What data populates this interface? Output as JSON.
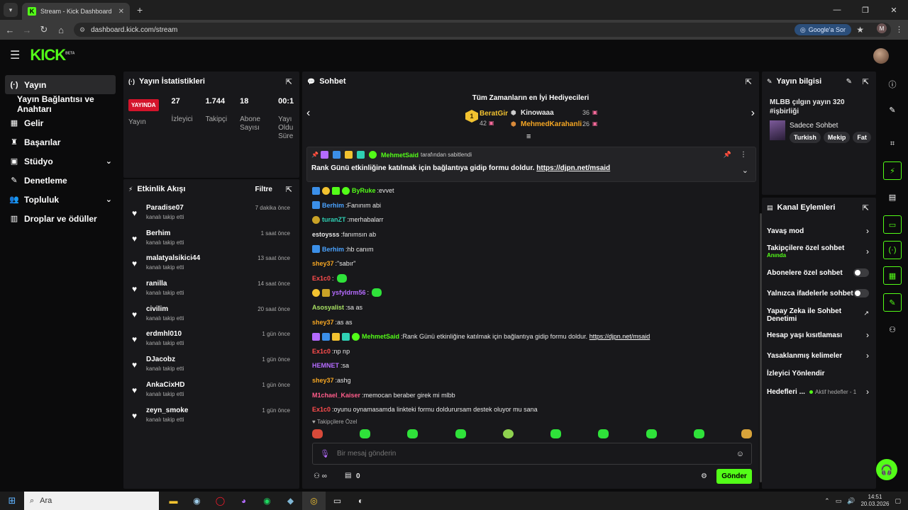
{
  "browser": {
    "tab_title": "Stream - Kick Dashboard",
    "url": "dashboard.kick.com/stream",
    "google_btn": "Google'a Sor",
    "profile_initial": "M"
  },
  "brand": {
    "logo": "KICK",
    "beta": "BETA",
    "accent": "#53fc18"
  },
  "sidebar": {
    "items": [
      {
        "icon": "(·)",
        "label": "Yayın"
      },
      {
        "icon": "",
        "label": "Yayın Bağlantısı ve Anahtarı"
      },
      {
        "icon": "▦",
        "label": "Gelir"
      },
      {
        "icon": "♜",
        "label": "Başarılar"
      },
      {
        "icon": "▣",
        "label": "Stüdyo"
      },
      {
        "icon": "✎",
        "label": "Denetleme"
      },
      {
        "icon": "👥",
        "label": "Topluluk"
      },
      {
        "icon": "▥",
        "label": "Droplar ve ödüller"
      }
    ]
  },
  "stats": {
    "title": "Yayın İstatistikleri",
    "live": "YAYINDA",
    "live_label": "Yayın",
    "viewers": "27",
    "viewers_label": "İzleyici",
    "followers": "1.744",
    "followers_label": "Takipçi",
    "subs": "18",
    "subs_label": "Abone Sayısı",
    "duration": "00:1",
    "duration_label": "Yayı Oldu Süre"
  },
  "activity": {
    "title": "Etkinlik Akışı",
    "filter": "Filtre",
    "items": [
      {
        "name": "Paradise07",
        "sub": "kanalı takip etti",
        "time": "7 dakika önce"
      },
      {
        "name": "Berhim",
        "sub": "kanalı takip etti",
        "time": "1 saat önce"
      },
      {
        "name": "malatyalsikici44",
        "sub": "kanalı takip etti",
        "time": "13 saat önce"
      },
      {
        "name": "ranilla",
        "sub": "kanalı takip etti",
        "time": "14 saat önce"
      },
      {
        "name": "civilim",
        "sub": "kanalı takip etti",
        "time": "20 saat önce"
      },
      {
        "name": "erdmhl010",
        "sub": "kanalı takip etti",
        "time": "1 gün önce"
      },
      {
        "name": "DJacobz",
        "sub": "kanalı takip etti",
        "time": "1 gün önce"
      },
      {
        "name": "AnkaCixHD",
        "sub": "kanalı takip etti",
        "time": "1 gün önce"
      },
      {
        "name": "zeyn_smoke",
        "sub": "kanalı takip etti",
        "time": "1 gün önce"
      }
    ]
  },
  "chat": {
    "title": "Sohbet",
    "gifters_title": "Tüm Zamanların en İyi Hediyecileri",
    "gifter1": {
      "rank": "1",
      "name": "BeratGir",
      "value": "42"
    },
    "gifter2": {
      "name": "Kinowaaa",
      "value": "36"
    },
    "gifter3": {
      "name": "MehmedKarahanli",
      "value": "26"
    },
    "pinned": {
      "by_user": "MehmetSaid",
      "by_suffix": "tarafından sabitlendi",
      "text": "Rank Günü etkinliğine katılmak için bağlantıya gidip formu doldur.",
      "link": "https://djpn.net/msaid"
    },
    "messages": [
      {
        "user": "ByRuke",
        "color": "#53fc18",
        "text": "evvet"
      },
      {
        "user": "Berhim",
        "color": "#4aa3ff",
        "text": "Fanınım abi"
      },
      {
        "user": "turanZT",
        "color": "#2fd1b5",
        "text": "merhabalarr"
      },
      {
        "user": "estoysss",
        "color": "#e8e8e8",
        "text": "fanımsın ab"
      },
      {
        "user": "Berhim",
        "color": "#4aa3ff",
        "text": "hb canım"
      },
      {
        "user": "shey37",
        "color": "#f5a623",
        "text": "\"sabır\""
      },
      {
        "user": "Ex1c0",
        "color": "#ff4d4d",
        "text": ""
      },
      {
        "user": "ysfyldrm56",
        "color": "#b56bff",
        "text": ""
      },
      {
        "user": "Asosyalist",
        "color": "#a8e063",
        "text": "sa as"
      },
      {
        "user": "shey37",
        "color": "#f5a623",
        "text": "as as"
      },
      {
        "user": "MehmetSaid",
        "color": "#53fc18",
        "text": "Rank Günü etkinliğine katılmak için bağlantıya gidip formu doldur.",
        "link": "https://djpn.net/msaid"
      },
      {
        "user": "Ex1c0",
        "color": "#ff4d4d",
        "text": "np np"
      },
      {
        "user": "HEMNET",
        "color": "#b56bff",
        "text": "sa"
      },
      {
        "user": "shey37",
        "color": "#f5a623",
        "text": "ashg"
      },
      {
        "user": "M1chael_Kaiser",
        "color": "#ff5c8a",
        "text": "memocan beraber girek mi mlbb"
      },
      {
        "user": "Ex1c0",
        "color": "#ff4d4d",
        "text": "oyunu oynamasamda linkteki formu doldurursam destek oluyor mu sana"
      }
    ],
    "followers_only": "Takipçilere Özel",
    "input_placeholder": "Bir mesaj gönderin",
    "points": "0",
    "send": "Gönder"
  },
  "stream_info": {
    "title": "Yayın bilgisi",
    "stream_title": "MLBB çılgın yayın 320 #işbirliği",
    "category": "Sadece Sohbet",
    "tags": [
      "Turkish",
      "Mekip",
      "Fat"
    ]
  },
  "channel_actions": {
    "title": "Kanal Eylemleri",
    "slow": "Yavaş mod",
    "followers_chat": "Takipçilere özel sohbet",
    "followers_chat_sub": "Anında",
    "subs_chat": "Abonelere özel sohbet",
    "emote_chat": "Yalnızca ifadelerle sohbet",
    "ai_mod": "Yapay Zeka ile Sohbet Denetimi",
    "age": "Hesap yaşı kısıtlaması",
    "banned": "Yasaklanmış kelimeler",
    "redirect": "İzleyici Yönlendir",
    "goals": "Hedefleri ...",
    "goals_sub": "Aktif hedefler - 1"
  },
  "taskbar": {
    "search": "Ara",
    "time": "14:51",
    "date": "20.03.2026"
  }
}
